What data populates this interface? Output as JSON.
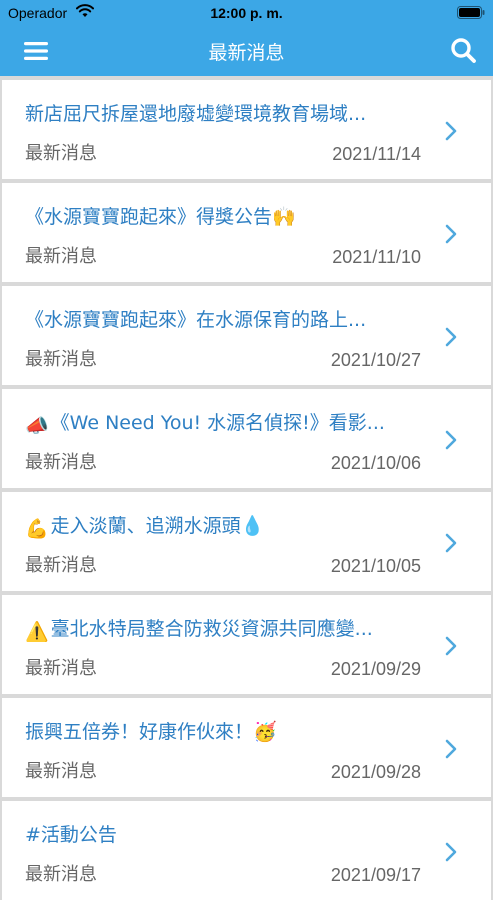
{
  "status_bar": {
    "carrier": "Operador",
    "time": "12:00 p. m."
  },
  "nav": {
    "title": "最新消息",
    "menu_icon": "hamburger-menu-icon",
    "search_icon": "search-icon"
  },
  "colors": {
    "accent": "#3ca7e6",
    "title_text": "#2e7fc3",
    "meta_text": "#666666",
    "chevron": "#4fa8dd"
  },
  "news": [
    {
      "title": "新店屈尺拆屋還地廢墟變環境教育場域...",
      "category": "最新消息",
      "date": "2021/11/14",
      "emoji": ""
    },
    {
      "title": "《水源寶寶跑起來》得獎公告🙌",
      "category": "最新消息",
      "date": "2021/11/10",
      "emoji": ""
    },
    {
      "title": "《水源寶寶跑起來》在水源保育的路上...",
      "category": "最新消息",
      "date": "2021/10/27",
      "emoji": ""
    },
    {
      "title": "《We Need You! 水源名偵探!》看影...",
      "category": "最新消息",
      "date": "2021/10/06",
      "emoji": "📣"
    },
    {
      "title": "走入淡蘭、追溯水源頭💧",
      "category": "最新消息",
      "date": "2021/10/05",
      "emoji": "💪"
    },
    {
      "title": "臺北水特局整合防救災資源共同應變...",
      "category": "最新消息",
      "date": "2021/09/29",
      "emoji": "⚠️"
    },
    {
      "title": "振興五倍券！好康作伙來！🥳",
      "category": "最新消息",
      "date": "2021/09/28",
      "emoji": ""
    },
    {
      "title": "#活動公告",
      "category": "最新消息",
      "date": "2021/09/17",
      "emoji": ""
    }
  ]
}
